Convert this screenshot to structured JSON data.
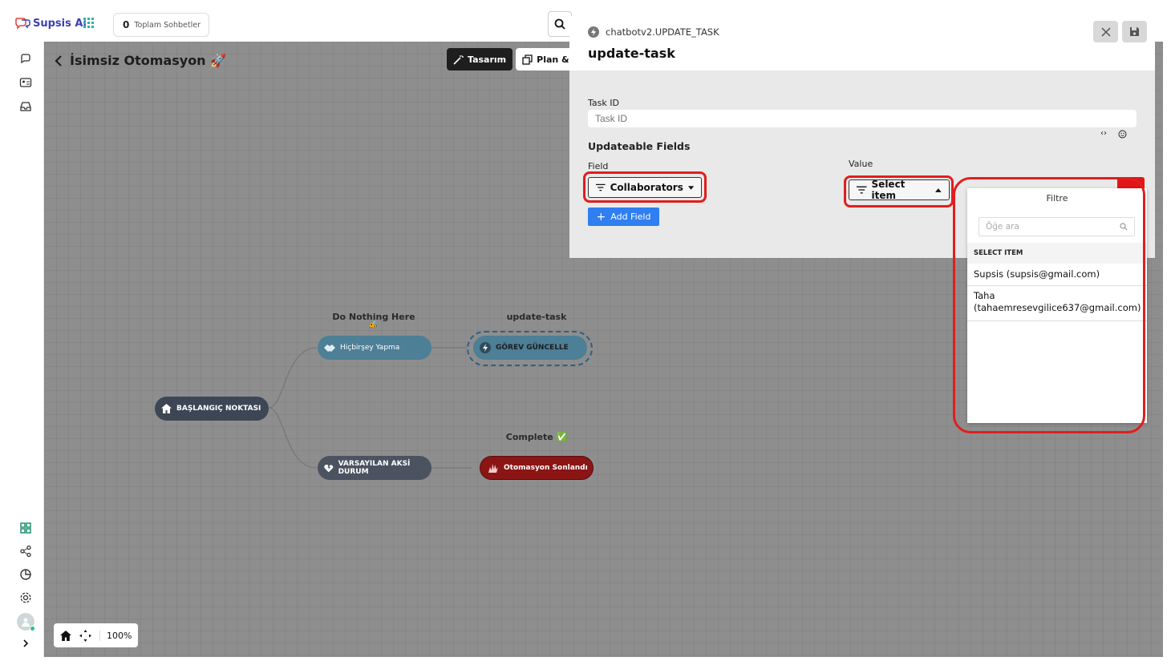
{
  "app": {
    "name": "Supsis Ai",
    "chat_count": "0",
    "chat_label": "Toplam Sohbetler"
  },
  "canvas": {
    "title": "İsimsiz Otomasyon 🚀",
    "tabs": [
      {
        "label": "Tasarım"
      },
      {
        "label": "Plan & G"
      }
    ],
    "zoom": "100%"
  },
  "flow": {
    "start": {
      "label": "BAŞLANGIÇ NOKTASI"
    },
    "do_nothing": {
      "title": "Do Nothing Here",
      "emoji": "🐝",
      "label": "Hiçbirşey Yapma"
    },
    "update": {
      "title": "update-task",
      "label": "GÖREV GÜNCELLE"
    },
    "default": {
      "label": "VARSAYILAN AKSİ DURUM"
    },
    "complete": {
      "title": "Complete ✅",
      "label": "Otomasyon Sonlandı"
    }
  },
  "panel": {
    "code": "chatbotv2.UPDATE_TASK",
    "title": "update-task",
    "task_id_label": "Task ID",
    "task_id_placeholder": "Task ID",
    "updateable_fields": "Updateable Fields",
    "field_label": "Field",
    "value_label": "Value",
    "field_value": "Collaborators",
    "value_value": "Select item",
    "add_field": "Add Field"
  },
  "dropdown": {
    "title": "Filtre",
    "search_placeholder": "Öğe ara",
    "header": "SELECT ITEM",
    "options": [
      {
        "label": "Supsis (supsis@gmail.com)"
      },
      {
        "label": "Taha (tahaemresevgilice637@gmail.com)"
      }
    ]
  },
  "colors": {
    "accent": "#2f7ef2",
    "highlight": "#e01e1e",
    "start_node": "#3d4655",
    "teal_node": "#4d7f96",
    "end_node": "#8b1515"
  }
}
